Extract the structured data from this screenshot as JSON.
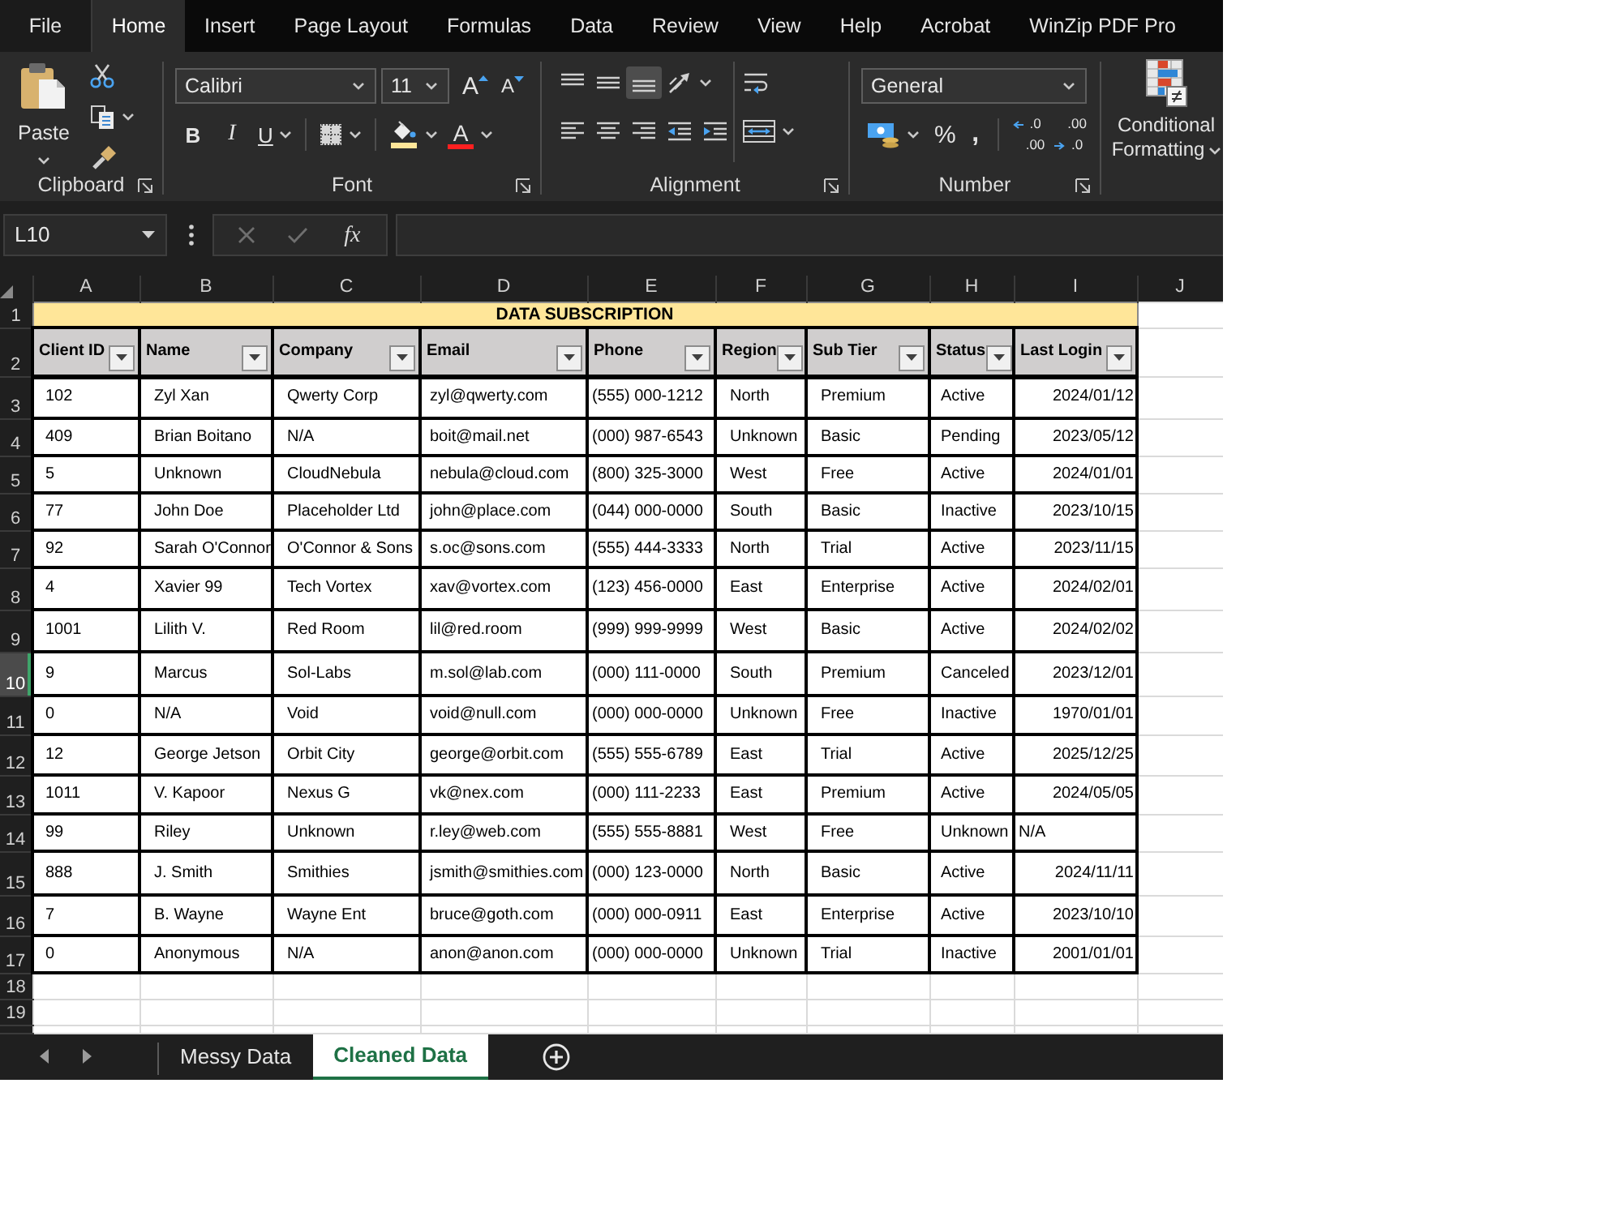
{
  "menu_tabs": [
    {
      "label": "File",
      "kind": "file",
      "selected": false
    },
    {
      "label": "Home",
      "kind": "tab",
      "selected": true
    },
    {
      "label": "Insert",
      "kind": "tab",
      "selected": false
    },
    {
      "label": "Page Layout",
      "kind": "tab",
      "selected": false
    },
    {
      "label": "Formulas",
      "kind": "tab",
      "selected": false
    },
    {
      "label": "Data",
      "kind": "tab",
      "selected": false
    },
    {
      "label": "Review",
      "kind": "tab",
      "selected": false
    },
    {
      "label": "View",
      "kind": "tab",
      "selected": false
    },
    {
      "label": "Help",
      "kind": "tab",
      "selected": false
    },
    {
      "label": "Acrobat",
      "kind": "tab",
      "selected": false
    },
    {
      "label": "WinZip PDF Pro",
      "kind": "tab",
      "selected": false
    }
  ],
  "ribbon": {
    "clipboard": {
      "paste_label": "Paste",
      "group_label": "Clipboard"
    },
    "font": {
      "font_name": "Calibri",
      "font_size": "11",
      "grow_label": "A",
      "shrink_label": "A",
      "bold_label": "B",
      "italic_label": "I",
      "underline_label": "U",
      "font_color_label": "A",
      "group_label": "Font"
    },
    "alignment": {
      "vertical": [
        {
          "kind": "top",
          "selected": false
        },
        {
          "kind": "middle",
          "selected": false
        },
        {
          "kind": "bottom",
          "selected": true
        }
      ],
      "horizontal": [
        {
          "kind": "left",
          "selected": false
        },
        {
          "kind": "center",
          "selected": false
        },
        {
          "kind": "right",
          "selected": false
        }
      ],
      "group_label": "Alignment"
    },
    "number": {
      "format": "General",
      "percent_label": "%",
      "comma_label": ",",
      "decimal_buttons": [
        {
          "kind": "increase",
          "top": ".0",
          "bottom": ".00"
        },
        {
          "kind": "decrease",
          "top": ".00",
          "bottom": ".0"
        }
      ],
      "group_label": "Number"
    },
    "styles": {
      "conditional_formatting_label": "Conditional Formatting"
    }
  },
  "formula_bar": {
    "name_box": "L10",
    "function_label": "fx"
  },
  "sheet": {
    "column_letters": [
      "A",
      "B",
      "C",
      "D",
      "E",
      "F",
      "G",
      "H",
      "I",
      "J"
    ],
    "row_numbers": [
      {
        "label": "1",
        "selected": false
      },
      {
        "label": "2",
        "selected": false
      },
      {
        "label": "3",
        "selected": false
      },
      {
        "label": "4",
        "selected": false
      },
      {
        "label": "5",
        "selected": false
      },
      {
        "label": "6",
        "selected": false
      },
      {
        "label": "7",
        "selected": false
      },
      {
        "label": "8",
        "selected": false
      },
      {
        "label": "9",
        "selected": false
      },
      {
        "label": "10",
        "selected": true
      },
      {
        "label": "11",
        "selected": false
      },
      {
        "label": "12",
        "selected": false
      },
      {
        "label": "13",
        "selected": false
      },
      {
        "label": "14",
        "selected": false
      },
      {
        "label": "15",
        "selected": false
      },
      {
        "label": "16",
        "selected": false
      },
      {
        "label": "17",
        "selected": false
      },
      {
        "label": "18",
        "selected": false
      },
      {
        "label": "19",
        "selected": false
      }
    ],
    "title": "DATA SUBSCRIPTION",
    "headers": [
      {
        "label": "Client ID",
        "filter": true
      },
      {
        "label": "Name",
        "filter": true
      },
      {
        "label": "Company",
        "filter": true
      },
      {
        "label": "Email",
        "filter": true
      },
      {
        "label": "Phone",
        "filter": true
      },
      {
        "label": "Region",
        "filter": true
      },
      {
        "label": "Sub Tier",
        "filter": true
      },
      {
        "label": "Status",
        "filter": true
      },
      {
        "label": "Last Login",
        "filter": true
      }
    ],
    "rows": [
      {
        "kind": "date",
        "cells": [
          "102",
          "Zyl Xan",
          "Qwerty Corp",
          "zyl@qwerty.com",
          "(555) 000-1212",
          "North",
          "Premium",
          "Active",
          "2024/01/12"
        ]
      },
      {
        "kind": "date",
        "cells": [
          "409",
          "Brian Boitano",
          "N/A",
          "boit@mail.net",
          "(000) 987-6543",
          "Unknown",
          "Basic",
          "Pending",
          "2023/05/12"
        ]
      },
      {
        "kind": "date",
        "cells": [
          "5",
          "Unknown",
          "CloudNebula",
          "nebula@cloud.com",
          "(800) 325-3000",
          "West",
          "Free",
          "Active",
          "2024/01/01"
        ]
      },
      {
        "kind": "date",
        "cells": [
          "77",
          "John Doe",
          "Placeholder Ltd",
          "john@place.com",
          "(044) 000-0000",
          "South",
          "Basic",
          "Inactive",
          "2023/10/15"
        ]
      },
      {
        "kind": "date",
        "cells": [
          "92",
          "Sarah O'Connor",
          "O'Connor & Sons",
          "s.oc@sons.com",
          "(555) 444-3333",
          "North",
          "Trial",
          "Active",
          "2023/11/15"
        ]
      },
      {
        "kind": "date",
        "cells": [
          "4",
          "Xavier 99",
          "Tech Vortex",
          "xav@vortex.com",
          "(123) 456-0000",
          "East",
          "Enterprise",
          "Active",
          "2024/02/01"
        ]
      },
      {
        "kind": "date",
        "cells": [
          "1001",
          "Lilith V.",
          "Red Room",
          "lil@red.room",
          "(999) 999-9999",
          "West",
          "Basic",
          "Active",
          "2024/02/02"
        ]
      },
      {
        "kind": "date",
        "cells": [
          "9",
          "Marcus",
          "Sol-Labs",
          "m.sol@lab.com",
          "(000) 111-0000",
          "South",
          "Premium",
          "Canceled",
          "2023/12/01"
        ]
      },
      {
        "kind": "date",
        "cells": [
          "0",
          "N/A",
          "Void",
          "void@null.com",
          "(000) 000-0000",
          "Unknown",
          "Free",
          "Inactive",
          "1970/01/01"
        ]
      },
      {
        "kind": "date",
        "cells": [
          "12",
          "George Jetson",
          "Orbit City",
          "george@orbit.com",
          "(555) 555-6789",
          "East",
          "Trial",
          "Active",
          "2025/12/25"
        ]
      },
      {
        "kind": "date",
        "cells": [
          "1011",
          "V. Kapoor",
          "Nexus G",
          "vk@nex.com",
          "(000) 111-2233",
          "East",
          "Premium",
          "Active",
          "2024/05/05"
        ]
      },
      {
        "kind": "text",
        "cells": [
          "99",
          "Riley",
          "Unknown",
          "r.ley@web.com",
          "(555) 555-8881",
          "West",
          "Free",
          "Unknown",
          "N/A"
        ]
      },
      {
        "kind": "date",
        "cells": [
          "888",
          "J. Smith",
          "Smithies",
          "jsmith@smithies.com",
          "(000) 123-0000",
          "North",
          "Basic",
          "Active",
          "2024/11/11"
        ]
      },
      {
        "kind": "date",
        "cells": [
          "7",
          "B. Wayne",
          "Wayne Ent",
          "bruce@goth.com",
          "(000) 000-0911",
          "East",
          "Enterprise",
          "Active",
          "2023/10/10"
        ]
      },
      {
        "kind": "date",
        "cells": [
          "0",
          "Anonymous",
          "N/A",
          "anon@anon.com",
          "(000) 000-0000",
          "Unknown",
          "Trial",
          "Inactive",
          "2001/01/01"
        ]
      }
    ]
  },
  "sheet_tabs": [
    {
      "label": "Messy Data",
      "selected": false
    },
    {
      "label": "Cleaned Data",
      "selected": true
    }
  ]
}
